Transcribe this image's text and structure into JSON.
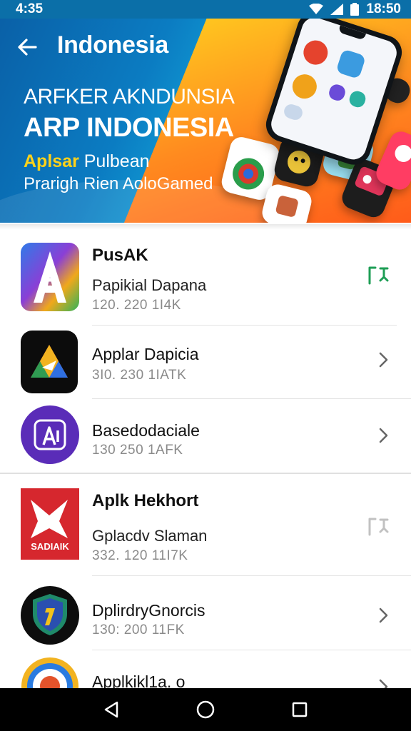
{
  "status_bar": {
    "time_left": "4:35",
    "time_right": "18:50"
  },
  "banner": {
    "title": "Indonesia",
    "kicker": "ARFKER AKNDUNSIA",
    "headline": "ARP INDONESIA",
    "sub1_highlight": "Aplsar",
    "sub1_rest": " Pulbean",
    "sub2": "Prarigh Rien AoloGamed"
  },
  "list": {
    "items": [
      {
        "title": "PusAK",
        "subtitle": "Papikial Dapana",
        "meta": "120. 220  1I4K",
        "icon": "letter-a-gradient-icon",
        "trailing": "update-icon"
      },
      {
        "title": "Applar Dapicia",
        "subtitle": "",
        "meta": "3I0. 230  1IATK",
        "icon": "triangle-play-icon",
        "trailing": "chevron-right-icon"
      },
      {
        "title": "Basedodaciale",
        "subtitle": "",
        "meta": "130  250  1AFK",
        "icon": "purple-circle-a-icon",
        "trailing": "chevron-right-icon"
      },
      {
        "title": "Aplk Hekhort",
        "subtitle": "Gplacdv Slaman",
        "meta": "332. 120  11I7K",
        "icon": "red-shield-icon",
        "trailing": "update-icon"
      },
      {
        "title": "DplirdryGnorcis",
        "subtitle": "",
        "meta": "130: 200  11FK",
        "icon": "shield-badge-icon",
        "trailing": "chevron-right-icon"
      },
      {
        "title": "Applkikl1a. o",
        "subtitle": "",
        "meta": "",
        "icon": "ring-gradient-icon",
        "trailing": "chevron-right-icon"
      }
    ]
  },
  "colors": {
    "banner_blue": "#0b6fa8",
    "banner_orange": "#ff8a1f",
    "accent_yellow": "#ffd21a",
    "update_green": "#1e9e55"
  }
}
